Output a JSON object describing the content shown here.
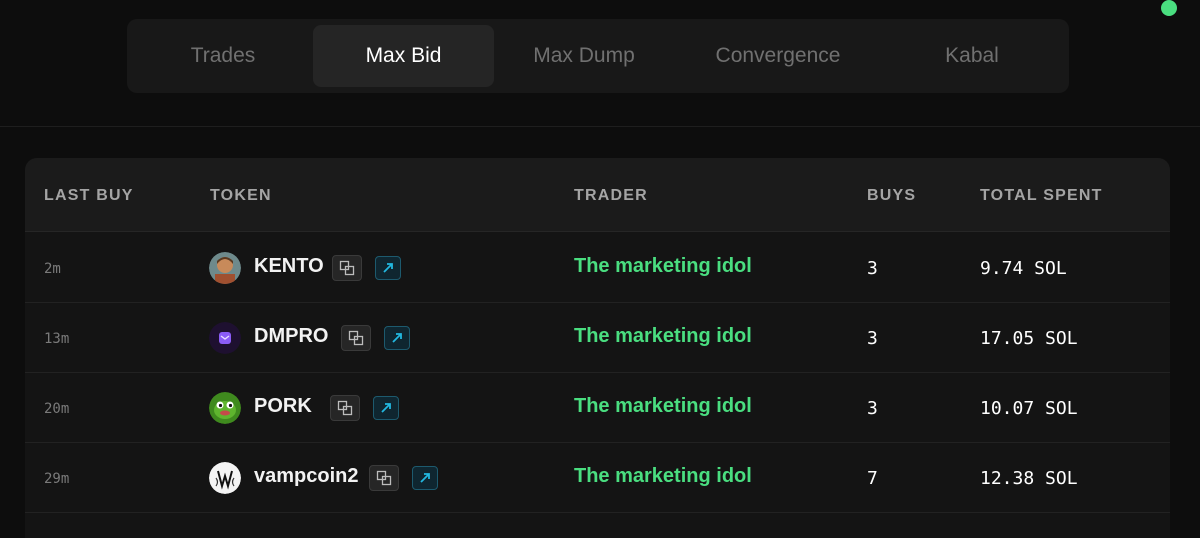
{
  "tabs": [
    {
      "label": "Trades",
      "active": false
    },
    {
      "label": "Max Bid",
      "active": true
    },
    {
      "label": "Max Dump",
      "active": false
    },
    {
      "label": "Convergence",
      "active": false
    },
    {
      "label": "Kabal",
      "active": false
    }
  ],
  "table": {
    "headers": {
      "last_buy": "LAST BUY",
      "token": "TOKEN",
      "trader": "TRADER",
      "buys": "BUYS",
      "total_spent": "TOTAL SPENT"
    },
    "rows": [
      {
        "last_buy": "2m",
        "token": "KENTO",
        "trader": "The marketing idol",
        "buys": "3",
        "total_spent": "9.74 SOL",
        "avatar_icon": "kento-avatar-icon"
      },
      {
        "last_buy": "13m",
        "token": "DMPRO",
        "trader": "The marketing idol",
        "buys": "3",
        "total_spent": "17.05 SOL",
        "avatar_icon": "dmpro-avatar-icon"
      },
      {
        "last_buy": "20m",
        "token": "PORK",
        "trader": "The marketing idol",
        "buys": "3",
        "total_spent": "10.07 SOL",
        "avatar_icon": "pork-avatar-icon"
      },
      {
        "last_buy": "29m",
        "token": "vampcoin2",
        "trader": "The marketing idol",
        "buys": "7",
        "total_spent": "12.38 SOL",
        "avatar_icon": "vampcoin2-avatar-icon"
      }
    ]
  },
  "colors": {
    "accent_green": "#4ade80",
    "link_cyan": "#22b8e0",
    "background": "#0d0d0d"
  }
}
